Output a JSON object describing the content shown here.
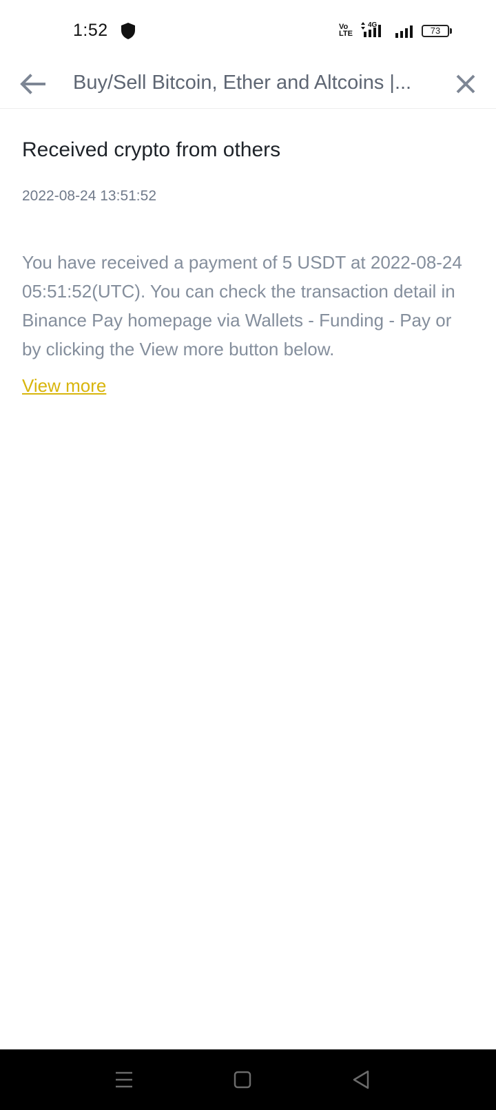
{
  "status_bar": {
    "time": "1:52",
    "volte_label": "Vo\nLTE",
    "network_label": "4G",
    "battery_level": "73",
    "icons": [
      "shield-icon",
      "volte-icon",
      "signal-4g-icon",
      "signal-icon",
      "battery-icon"
    ]
  },
  "header": {
    "title": "Buy/Sell Bitcoin, Ether and Altcoins |...",
    "back_icon": "arrow-left-icon",
    "close_icon": "close-icon"
  },
  "message": {
    "title": "Received crypto from others",
    "date": "2022-08-24 13:51:52",
    "body": "You have received a payment of 5 USDT at 2022-08-24 05:51:52(UTC). You can check the transaction detail in Binance Pay homepage via Wallets - Funding - Pay or by clicking the View more button below.",
    "link_label": "View more"
  },
  "nav_bar": {
    "icons": [
      "menu-icon",
      "home-icon",
      "back-triangle-icon"
    ]
  },
  "colors": {
    "link": "#d8b50c",
    "title_text": "#1e2329",
    "secondary_text": "#848e9c",
    "header_text": "#5e6673",
    "nav_background": "#000000"
  }
}
